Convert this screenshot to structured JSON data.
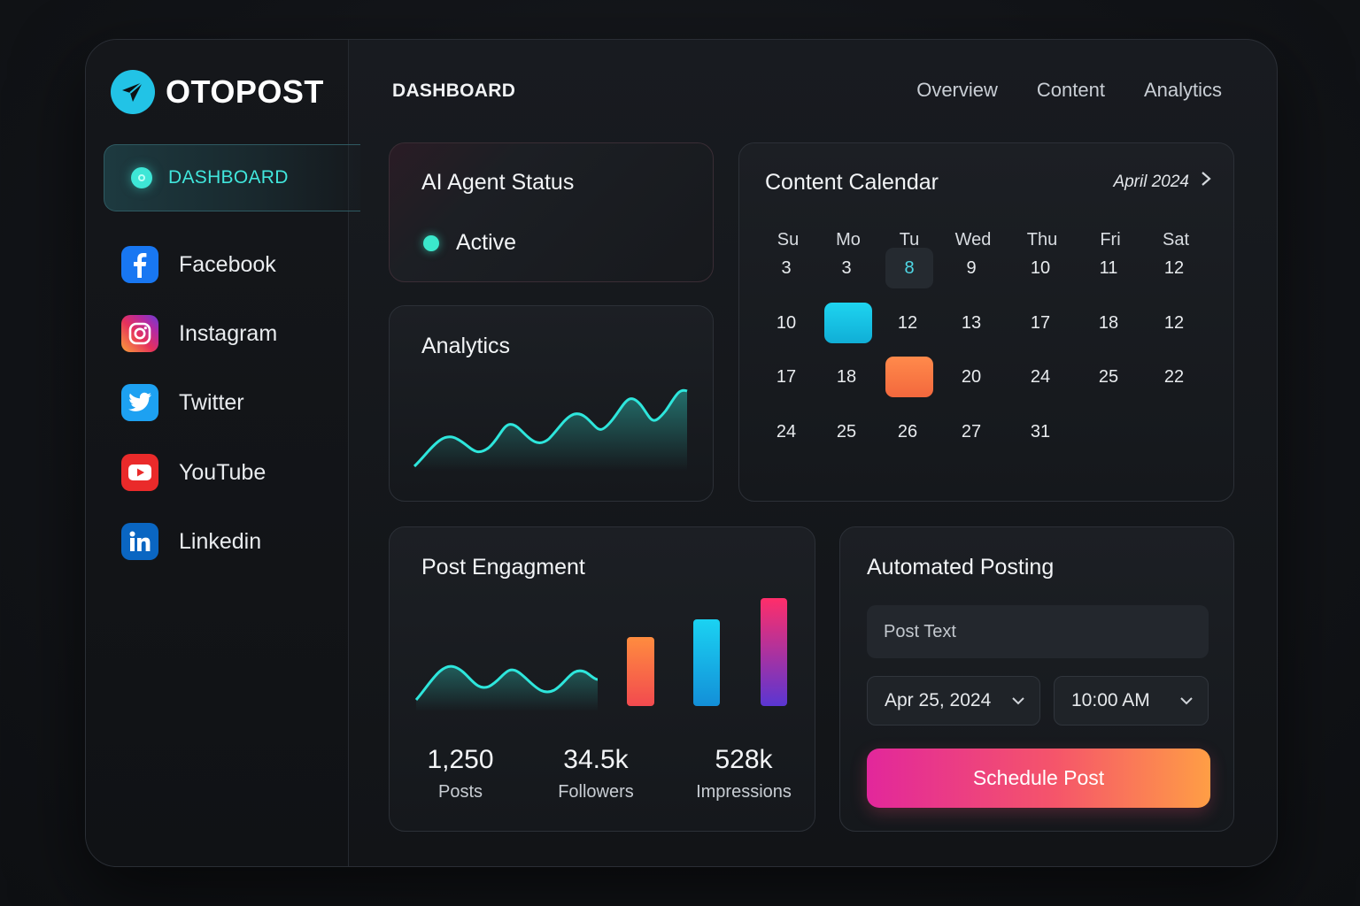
{
  "brand": {
    "name": "OTOPOST"
  },
  "sidebar": {
    "active": {
      "label": "DASHBOARD"
    },
    "items": [
      {
        "label": "Facebook",
        "icon": "facebook-icon",
        "color": "#1877f2"
      },
      {
        "label": "Instagram",
        "icon": "instagram-icon",
        "color": "#e1306c"
      },
      {
        "label": "Twitter",
        "icon": "twitter-icon",
        "color": "#1da1f2"
      },
      {
        "label": "YouTube",
        "icon": "youtube-icon",
        "color": "#ff0000"
      },
      {
        "label": "Linkedin",
        "icon": "linkedin-icon",
        "color": "#0a66c2"
      }
    ]
  },
  "header": {
    "title": "DASHBOARD",
    "tabs": [
      "Overview",
      "Content",
      "Analytics"
    ]
  },
  "agent": {
    "title": "AI Agent Status",
    "status": "Active",
    "status_color": "#3be8cc"
  },
  "analytics": {
    "title": "Analytics"
  },
  "calendar": {
    "title": "Content Calendar",
    "month": "April 2024",
    "weekdays": [
      "Su",
      "Mo",
      "Tu",
      "Wed",
      "Thu",
      "Fri",
      "Sat"
    ],
    "weeks": [
      [
        "3",
        "3",
        "8",
        "9",
        "10",
        "11",
        "12"
      ],
      [
        "10",
        "",
        "12",
        "13",
        "17",
        "18",
        "12"
      ],
      [
        "17",
        "18",
        "",
        "20",
        "24",
        "25",
        "22"
      ],
      [
        "24",
        "25",
        "26",
        "27",
        "31",
        "",
        ""
      ]
    ]
  },
  "engagement": {
    "title": "Post Engagment",
    "stats": [
      {
        "value": "1,250",
        "label": "Posts"
      },
      {
        "value": "34.5k",
        "label": "Followers"
      },
      {
        "value": "528k",
        "label": "Impressions"
      }
    ]
  },
  "automated": {
    "title": "Automated Posting",
    "post_placeholder": "Post Text",
    "date": "Apr 25, 2024",
    "time": "10:00 AM",
    "button": "Schedule Post"
  }
}
